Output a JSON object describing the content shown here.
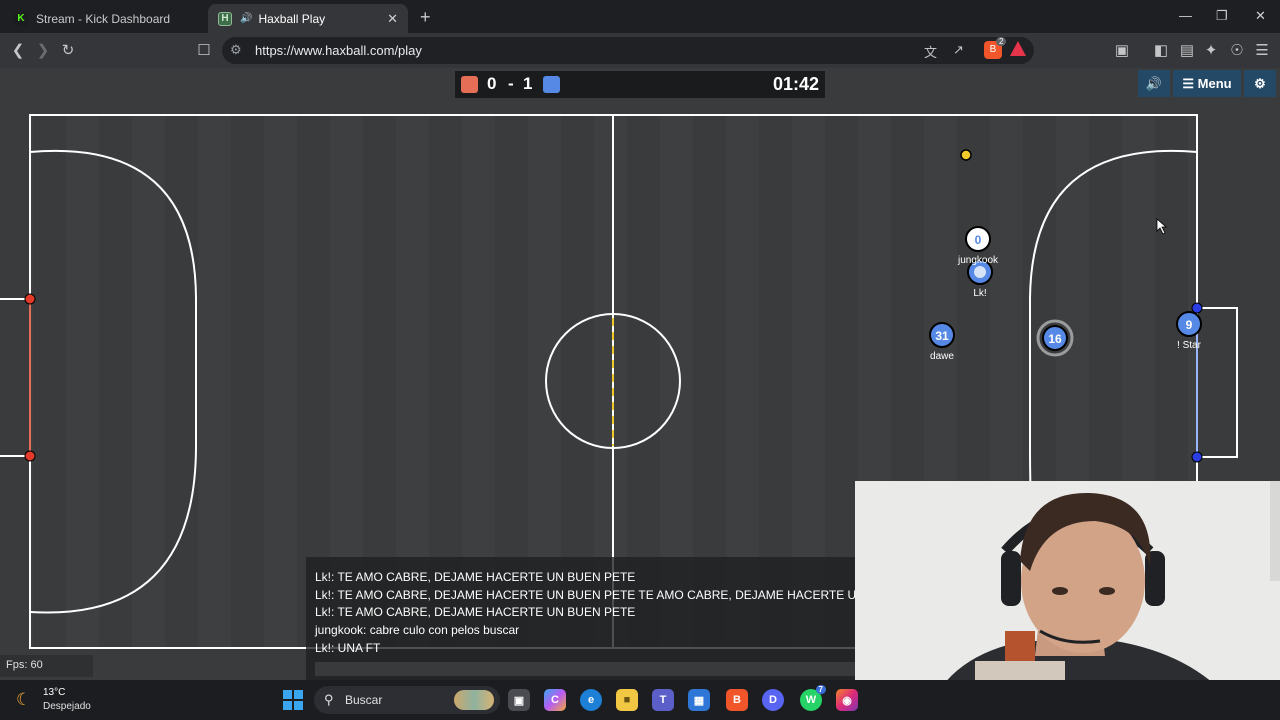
{
  "browser": {
    "tabs": [
      {
        "title": "Stream - Kick Dashboard",
        "favicon": "kick-icon",
        "active": false
      },
      {
        "title": "Haxball Play",
        "favicon": "haxball-icon",
        "active": true
      }
    ],
    "url": "https://www.haxball.com/play",
    "brave_badge": "2"
  },
  "game": {
    "score_red": "0",
    "score_separator": "-",
    "score_blue": "1",
    "clock": "01:42",
    "menu_label": "Menu",
    "fps_label": "Fps: 60",
    "colors": {
      "red_team": "#e56e56",
      "blue_team": "#5689e5",
      "pitch": "#3a3b3c",
      "ball": "#f0c92b"
    },
    "players": [
      {
        "number": "0",
        "name": "jungkook",
        "team": "blue"
      },
      {
        "number": "",
        "name": "Lk!",
        "team": "blue"
      },
      {
        "number": "31",
        "name": "dawe",
        "team": "blue"
      },
      {
        "number": "16",
        "name": "",
        "team": "blue"
      },
      {
        "number": "9",
        "name": "! Star",
        "team": "blue"
      }
    ]
  },
  "chat": {
    "messages": [
      "Lk!: TE AMO CABRE, DEJAME HACERTE UN BUEN PETE",
      "Lk!: TE AMO CABRE, DEJAME HACERTE UN BUEN PETE TE AMO CABRE, DEJAME HACERTE UN BUEN PETE",
      "Lk!: TE AMO CABRE, DEJAME HACERTE UN BUEN PETE",
      "jungkook: cabre culo con pelos buscar",
      "Lk!: UNA FT"
    ]
  },
  "taskbar": {
    "temperature": "13°C",
    "weather": "Despejado",
    "search_label": "Buscar",
    "whatsapp_badge": "7"
  }
}
